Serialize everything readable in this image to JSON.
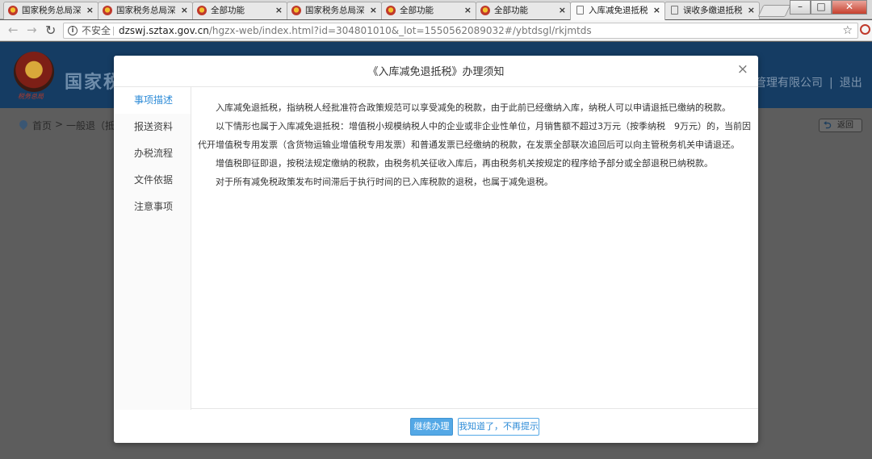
{
  "browser": {
    "tabs": [
      {
        "label": "国家税务总局深",
        "icon": "tax-emblem-icon"
      },
      {
        "label": "国家税务总局深",
        "icon": "tax-emblem-icon"
      },
      {
        "label": "全部功能",
        "icon": "tax-emblem-icon"
      },
      {
        "label": "国家税务总局深",
        "icon": "tax-emblem-icon"
      },
      {
        "label": "全部功能",
        "icon": "tax-emblem-icon"
      },
      {
        "label": "全部功能",
        "icon": "tax-emblem-icon"
      },
      {
        "label": "入库减免退抵税",
        "icon": "document-icon",
        "active": true
      },
      {
        "label": "误收多缴退抵税",
        "icon": "document-icon"
      }
    ],
    "tab_close_glyph": "×",
    "address": {
      "security_label": "不安全",
      "host": "dzswj.sztax.gov.cn",
      "path": "/hgzx-web/index.html?id=304801010&_lot=1550562089032#/ybtdsgl/rkjmtds"
    }
  },
  "page": {
    "site_title": "国家税",
    "emblem_caption": "税务总局",
    "company_fragment": "管理有限公司",
    "divider": "|",
    "logout": "退出",
    "breadcrumb": {
      "home": "首页",
      "gt": ">",
      "current": "一般退（抵"
    },
    "back_label": "返回"
  },
  "modal": {
    "title": "《入库减免退抵税》办理须知",
    "close_glyph": "×",
    "side_items": [
      "事项描述",
      "报送资料",
      "办税流程",
      "文件依据",
      "注意事项"
    ],
    "active_side": "事项描述",
    "paragraphs": [
      "入库减免退抵税，指纳税人经批准符合政策规范可以享受减免的税款，由于此前已经缴纳入库，纳税人可以申请退抵已缴纳的税款。",
      "以下情形也属于入库减免退抵税：增值税小规模纳税人中的企业或非企业性单位，月销售额不超过3万元（按季纳税　9万元）的，当前因代开增值税专用发票（含货物运输业增值税专用发票）和普通发票已经缴纳的税款，在发票全部联次追回后可以向主管税务机关申请退还。",
      "增值税即征即退，按税法规定缴纳的税款，由税务机关征收入库后，再由税务机关按规定的程序给予部分或全部退税已纳税款。",
      "对于所有减免税政策发布时间滞后于执行时间的已入库税款的退税，也属于减免退税。"
    ],
    "buttons": {
      "continue": "继续办理",
      "dismiss": "我知道了，不再提示"
    }
  }
}
